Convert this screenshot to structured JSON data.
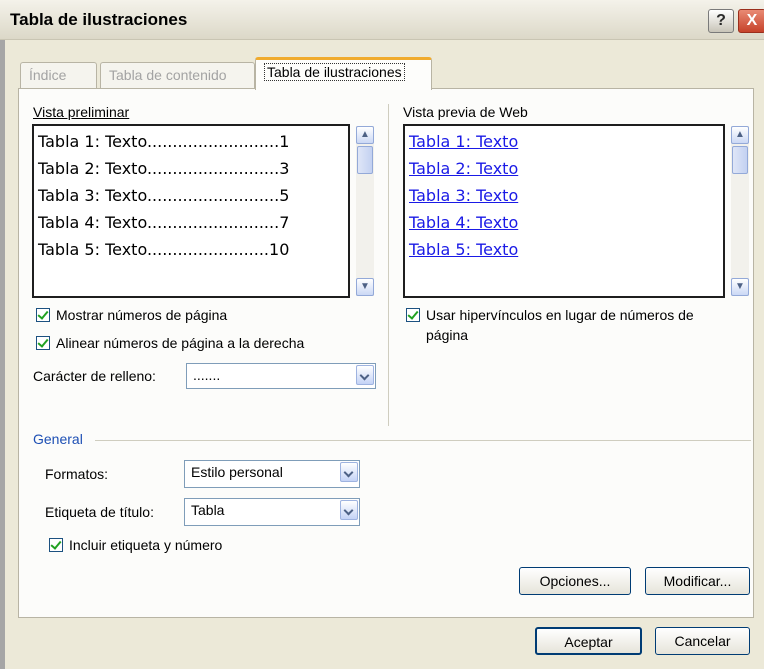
{
  "window": {
    "title": "Tabla de ilustraciones",
    "help_label": "?",
    "close_label": "X"
  },
  "tabs": [
    {
      "label": "Índice",
      "active": false
    },
    {
      "label": "Tabla de contenido",
      "active": false
    },
    {
      "label": "Tabla de ilustraciones",
      "active": true
    }
  ],
  "preview": {
    "label": "Vista preliminar",
    "items": [
      {
        "name": "Tabla 1: Texto",
        "dots": "..........................",
        "page": "1"
      },
      {
        "name": "Tabla 2: Texto",
        "dots": "..........................",
        "page": "3"
      },
      {
        "name": "Tabla 3: Texto",
        "dots": "..........................",
        "page": "5"
      },
      {
        "name": "Tabla 4: Texto",
        "dots": "..........................",
        "page": "7"
      },
      {
        "name": "Tabla 5: Texto",
        "dots": "........................",
        "page": "10"
      }
    ]
  },
  "web_preview": {
    "label": "Vista previa de Web",
    "items": [
      "Tabla 1: Texto",
      "Tabla 2: Texto",
      "Tabla 3: Texto",
      "Tabla 4: Texto",
      "Tabla 5: Texto"
    ]
  },
  "options": {
    "show_page_numbers": "Mostrar números de página",
    "align_right": "Alinear números de página a la derecha",
    "fill_char_label": "Carácter de relleno:",
    "fill_char_value": ".......",
    "hyperlinks_line1": "Usar hipervínculos en lugar de números de",
    "hyperlinks_line2": "página"
  },
  "general": {
    "title": "General",
    "formats_label": "Formatos:",
    "formats_value": "Estilo personal",
    "caption_label": "Etiqueta de título:",
    "caption_value": "Tabla",
    "include_label": "Incluir etiqueta y número"
  },
  "buttons": {
    "options": "Opciones...",
    "modify": "Modificar...",
    "ok": "Aceptar",
    "cancel": "Cancelar"
  }
}
